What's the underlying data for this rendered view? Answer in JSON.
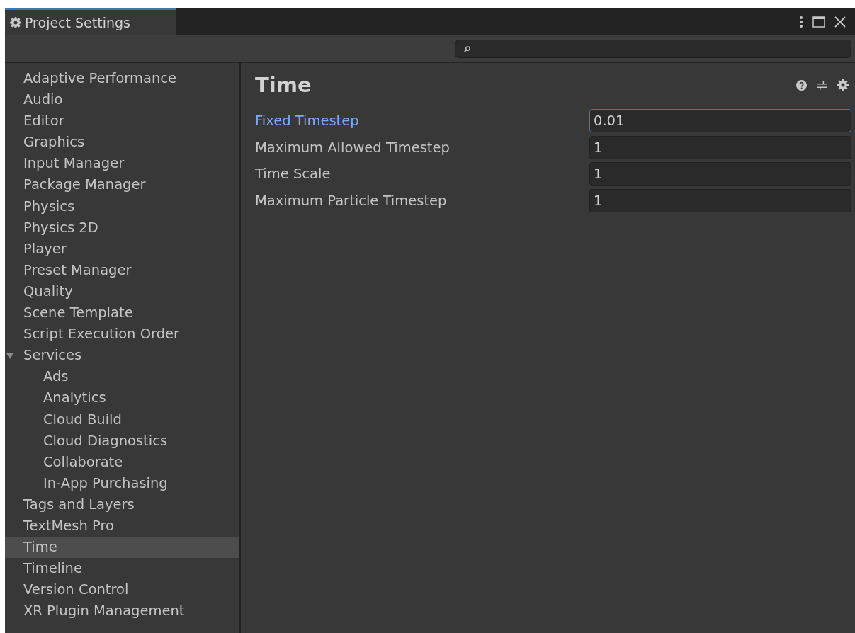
{
  "window": {
    "title": "Project Settings"
  },
  "sidebar": {
    "items": [
      {
        "label": "Adaptive Performance",
        "selected": false
      },
      {
        "label": "Audio",
        "selected": false
      },
      {
        "label": "Editor",
        "selected": false
      },
      {
        "label": "Graphics",
        "selected": false
      },
      {
        "label": "Input Manager",
        "selected": false
      },
      {
        "label": "Package Manager",
        "selected": false
      },
      {
        "label": "Physics",
        "selected": false
      },
      {
        "label": "Physics 2D",
        "selected": false
      },
      {
        "label": "Player",
        "selected": false
      },
      {
        "label": "Preset Manager",
        "selected": false
      },
      {
        "label": "Quality",
        "selected": false
      },
      {
        "label": "Scene Template",
        "selected": false
      },
      {
        "label": "Script Execution Order",
        "selected": false
      },
      {
        "label": "Services",
        "selected": false,
        "expanded": true,
        "children": [
          {
            "label": "Ads",
            "selected": false
          },
          {
            "label": "Analytics",
            "selected": false
          },
          {
            "label": "Cloud Build",
            "selected": false
          },
          {
            "label": "Cloud Diagnostics",
            "selected": false
          },
          {
            "label": "Collaborate",
            "selected": false
          },
          {
            "label": "In-App Purchasing",
            "selected": false
          }
        ]
      },
      {
        "label": "Tags and Layers",
        "selected": false
      },
      {
        "label": "TextMesh Pro",
        "selected": false
      },
      {
        "label": "Time",
        "selected": true
      },
      {
        "label": "Timeline",
        "selected": false
      },
      {
        "label": "Version Control",
        "selected": false
      },
      {
        "label": "XR Plugin Management",
        "selected": false
      }
    ]
  },
  "content": {
    "title": "Time",
    "fields": [
      {
        "label": "Fixed Timestep",
        "value": "0.01",
        "focused": true
      },
      {
        "label": "Maximum Allowed Timestep",
        "value": "1",
        "focused": false
      },
      {
        "label": "Time Scale",
        "value": "1",
        "focused": false
      },
      {
        "label": "Maximum Particle Timestep",
        "value": "1",
        "focused": false
      }
    ]
  }
}
